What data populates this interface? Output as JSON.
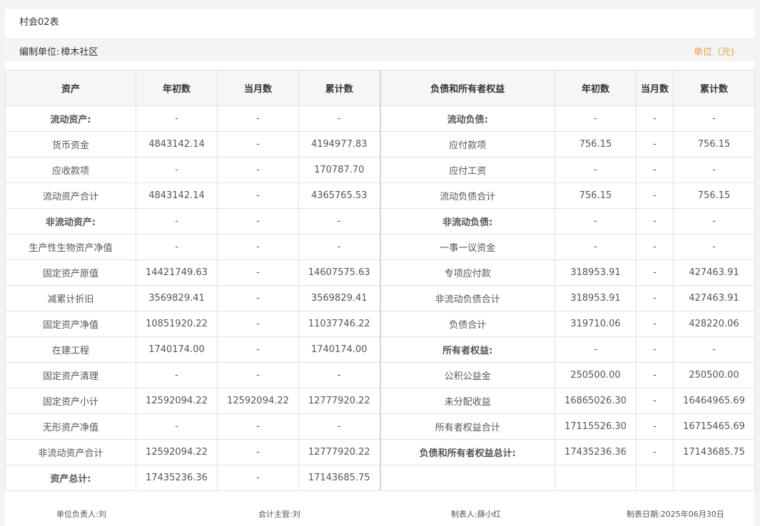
{
  "form_title": "村会02表",
  "org_label": "编制单位:",
  "org_value": "樟木社区",
  "unit_label": "单位（元)",
  "headers": [
    "资产",
    "年初数",
    "当月数",
    "累计数",
    "负债和所有者权益",
    "年初数",
    "当月数",
    "累计数"
  ],
  "rows": [
    {
      "a_label": "流动资产:",
      "a_bold": true,
      "a_begin": "-",
      "a_month": "-",
      "a_cum": "-",
      "l_label": "流动负债:",
      "l_bold": true,
      "l_begin": "-",
      "l_month": "-",
      "l_cum": "-"
    },
    {
      "a_label": "货币资金",
      "a_bold": false,
      "a_begin": "4843142.14",
      "a_month": "-",
      "a_cum": "4194977.83",
      "l_label": "应付款项",
      "l_bold": false,
      "l_begin": "756.15",
      "l_month": "-",
      "l_cum": "756.15"
    },
    {
      "a_label": "应收款项",
      "a_bold": false,
      "a_begin": "-",
      "a_month": "-",
      "a_cum": "170787.70",
      "l_label": "应付工资",
      "l_bold": false,
      "l_begin": "-",
      "l_month": "-",
      "l_cum": "-"
    },
    {
      "a_label": "流动资产合计",
      "a_bold": false,
      "a_begin": "4843142.14",
      "a_month": "-",
      "a_cum": "4365765.53",
      "l_label": "流动负债合计",
      "l_bold": false,
      "l_begin": "756.15",
      "l_month": "-",
      "l_cum": "756.15"
    },
    {
      "a_label": "非流动资产:",
      "a_bold": true,
      "a_begin": "-",
      "a_month": "-",
      "a_cum": "-",
      "l_label": "非流动负债:",
      "l_bold": true,
      "l_begin": "-",
      "l_month": "-",
      "l_cum": "-"
    },
    {
      "a_label": "生产性生物资产净值",
      "a_bold": false,
      "a_begin": "-",
      "a_month": "-",
      "a_cum": "-",
      "l_label": "一事一议资金",
      "l_bold": false,
      "l_begin": "-",
      "l_month": "-",
      "l_cum": "-"
    },
    {
      "a_label": "固定资产原值",
      "a_bold": false,
      "a_begin": "14421749.63",
      "a_month": "-",
      "a_cum": "14607575.63",
      "l_label": "专项应付款",
      "l_bold": false,
      "l_begin": "318953.91",
      "l_month": "-",
      "l_cum": "427463.91"
    },
    {
      "a_label": "减累计折旧",
      "a_bold": false,
      "a_begin": "3569829.41",
      "a_month": "-",
      "a_cum": "3569829.41",
      "l_label": "非流动负债合计",
      "l_bold": false,
      "l_begin": "318953.91",
      "l_month": "-",
      "l_cum": "427463.91"
    },
    {
      "a_label": "固定资产净值",
      "a_bold": false,
      "a_begin": "10851920.22",
      "a_month": "-",
      "a_cum": "11037746.22",
      "l_label": "负债合计",
      "l_bold": false,
      "l_begin": "319710.06",
      "l_month": "-",
      "l_cum": "428220.06"
    },
    {
      "a_label": "在建工程",
      "a_bold": false,
      "a_begin": "1740174.00",
      "a_month": "-",
      "a_cum": "1740174.00",
      "l_label": "所有者权益:",
      "l_bold": true,
      "l_begin": "-",
      "l_month": "-",
      "l_cum": "-"
    },
    {
      "a_label": "固定资产清理",
      "a_bold": false,
      "a_begin": "-",
      "a_month": "-",
      "a_cum": "-",
      "l_label": "公积公益金",
      "l_bold": false,
      "l_begin": "250500.00",
      "l_month": "-",
      "l_cum": "250500.00"
    },
    {
      "a_label": "固定资产小计",
      "a_bold": false,
      "a_begin": "12592094.22",
      "a_month": "12592094.22",
      "a_cum": "12777920.22",
      "l_label": "未分配收益",
      "l_bold": false,
      "l_begin": "16865026.30",
      "l_month": "-",
      "l_cum": "16464965.69"
    },
    {
      "a_label": "无形资产净值",
      "a_bold": false,
      "a_begin": "-",
      "a_month": "-",
      "a_cum": "-",
      "l_label": "所有者权益合计",
      "l_bold": false,
      "l_begin": "17115526.30",
      "l_month": "-",
      "l_cum": "16715465.69"
    },
    {
      "a_label": "非流动资产合计",
      "a_bold": false,
      "a_begin": "12592094.22",
      "a_month": "-",
      "a_cum": "12777920.22",
      "l_label": "负债和所有者权益总计:",
      "l_bold": true,
      "l_begin": "17435236.36",
      "l_month": "-",
      "l_cum": "17143685.75"
    },
    {
      "a_label": "资产总计:",
      "a_bold": true,
      "a_begin": "17435236.36",
      "a_month": "-",
      "a_cum": "17143685.75",
      "l_label": "",
      "l_bold": false,
      "l_begin": "",
      "l_month": "",
      "l_cum": ""
    }
  ],
  "footer": {
    "head_label": "单位负责人:",
    "head_value": "刘",
    "accountant_label": "会计主管:",
    "accountant_value": "刘",
    "preparer_label": "制表人:",
    "preparer_value": "薛小红",
    "date_label": "制表日期:",
    "date_value": "2025年06月30日"
  },
  "colors": {
    "link": "#1e88e5",
    "unit": "#e6a23c",
    "header_bg": "#f6f6f6",
    "border": "#e2e2e2"
  }
}
